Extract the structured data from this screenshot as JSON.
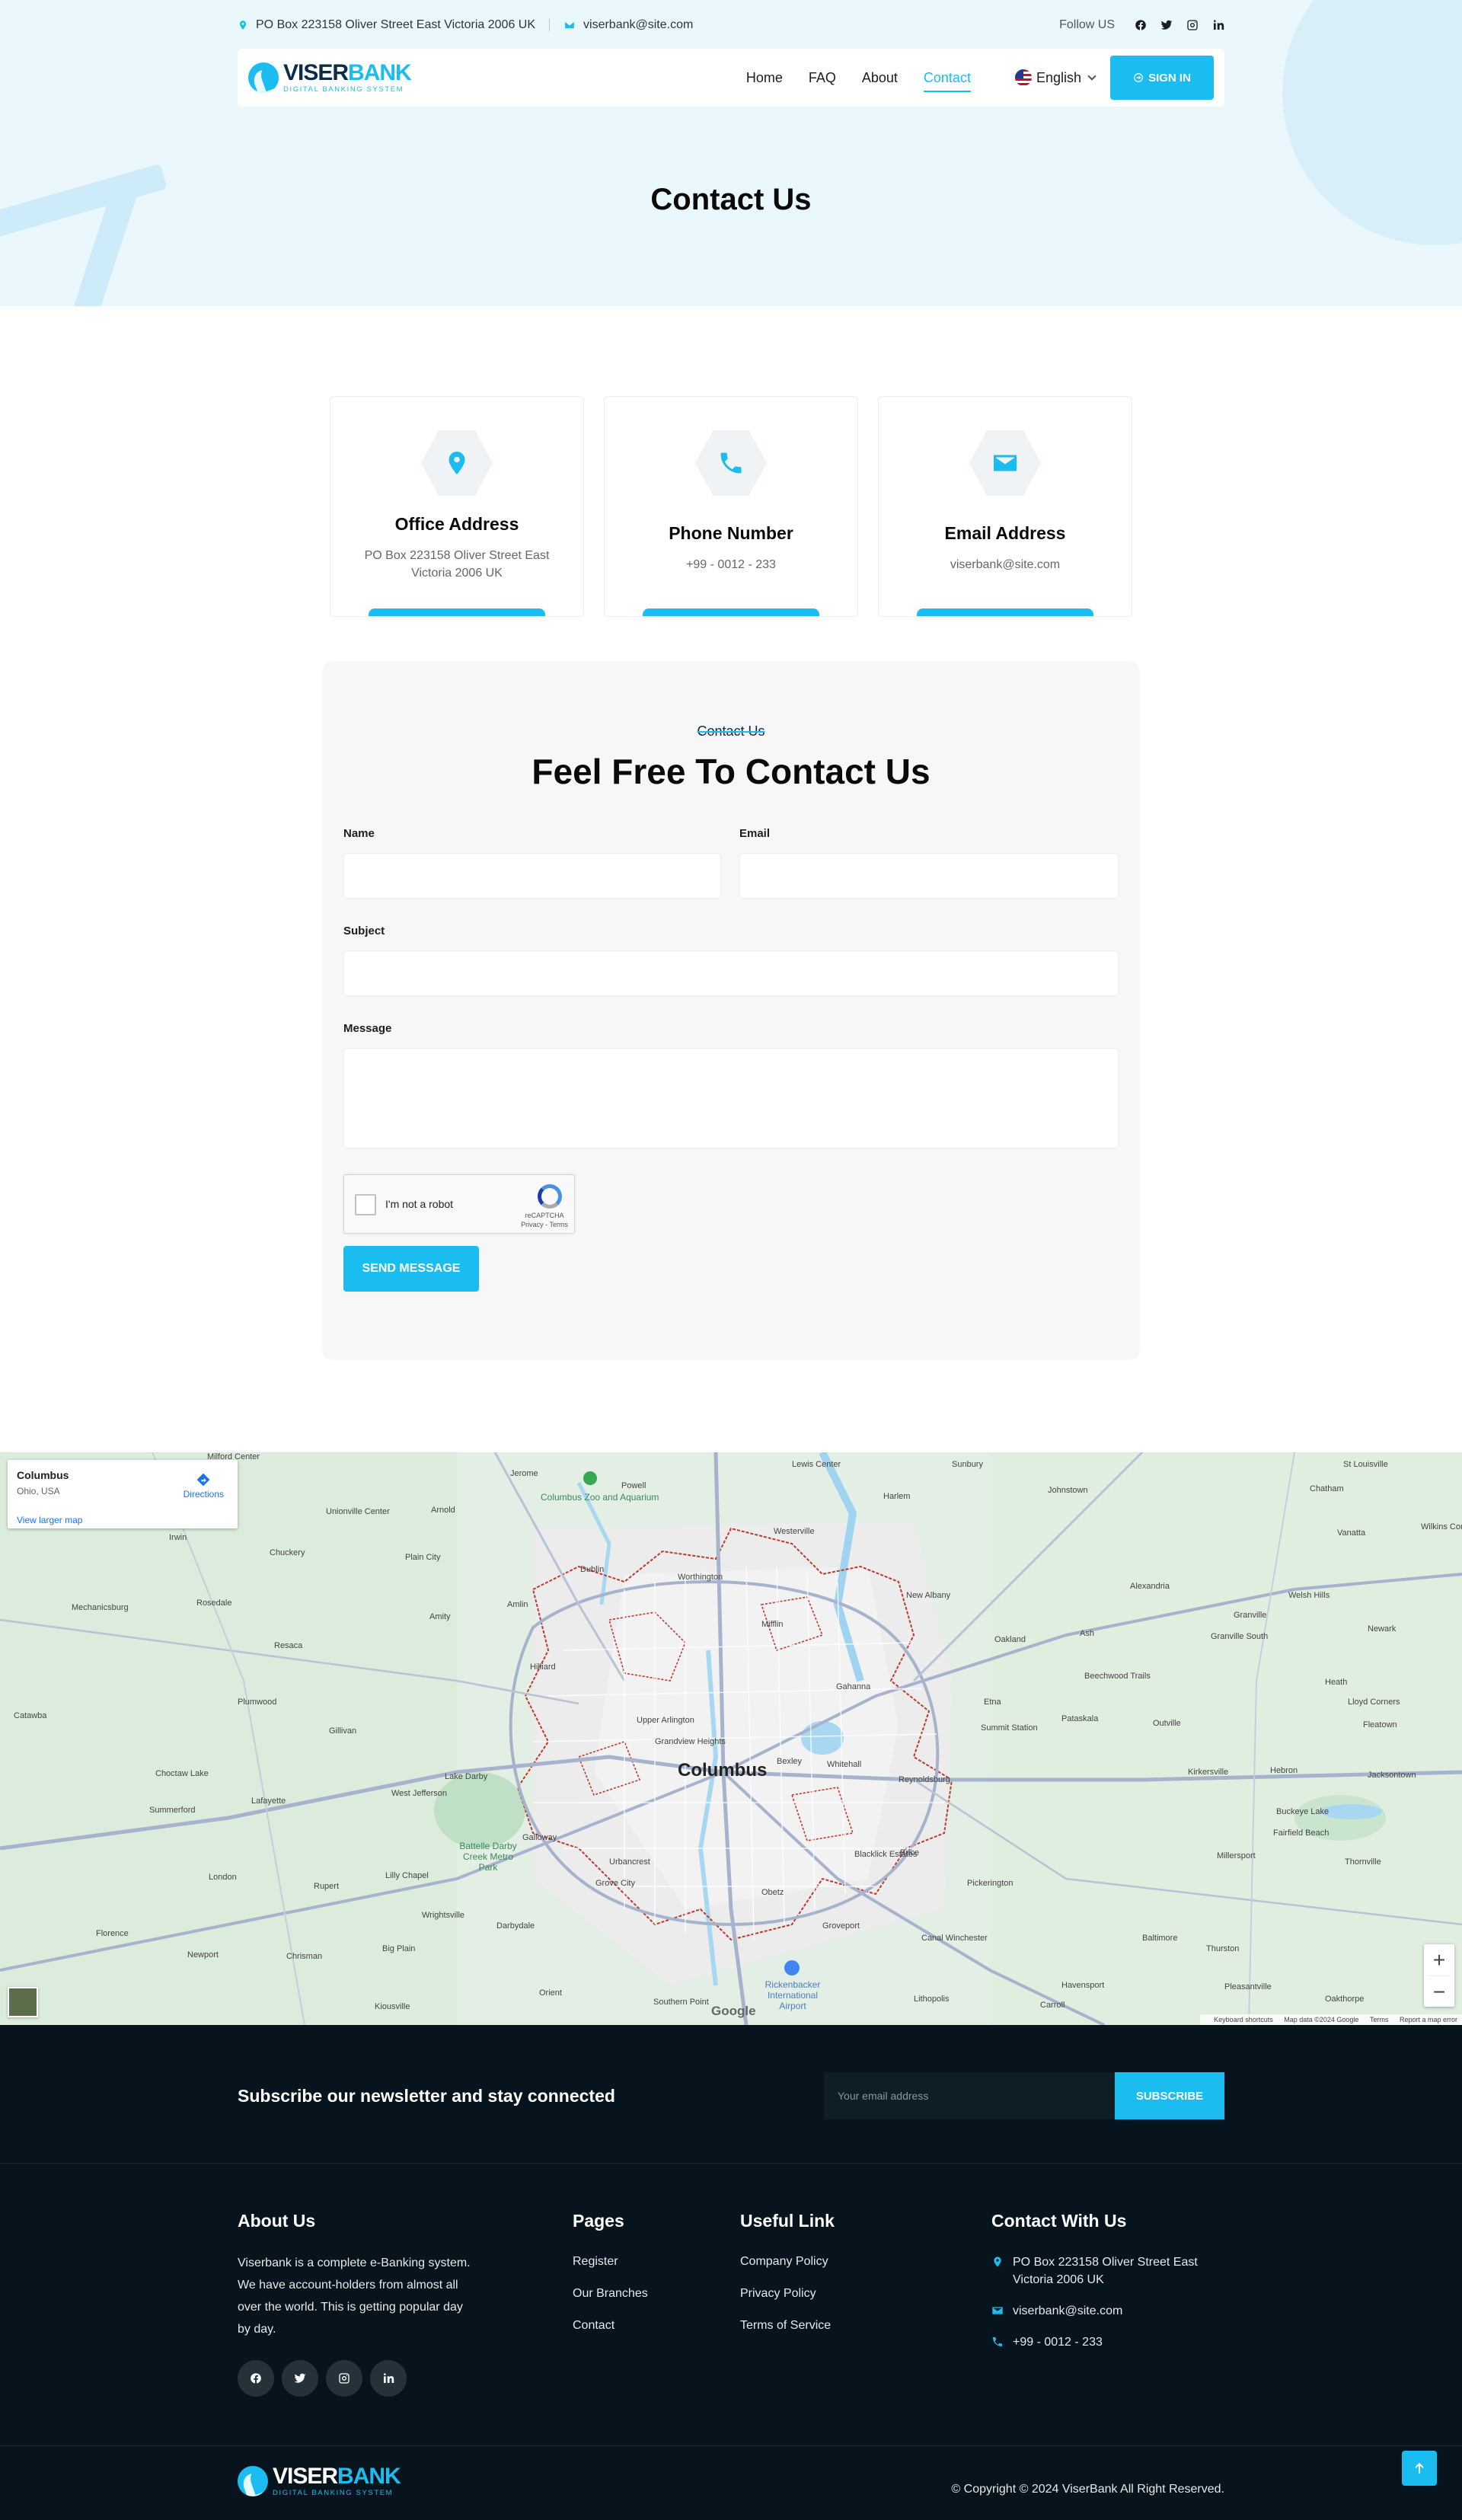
{
  "topbar": {
    "address": "PO Box 223158 Oliver Street East Victoria 2006 UK",
    "email": "viserbank@site.com",
    "follow_label": "Follow US",
    "socials": [
      "facebook-icon",
      "twitter-icon",
      "instagram-icon",
      "linkedin-icon"
    ]
  },
  "brand": {
    "name_part1": "VISER",
    "name_part2": "BANK",
    "tagline": "DIGITAL BANKING SYSTEM",
    "accent": "#1bbdf0",
    "dark": "#07141d"
  },
  "nav": {
    "links": [
      "Home",
      "FAQ",
      "About",
      "Contact"
    ],
    "active": "Contact",
    "language": "English",
    "signin_label": "SIGN IN"
  },
  "hero": {
    "title": "Contact Us"
  },
  "info_cards": [
    {
      "icon": "map-pin-icon",
      "title": "Office Address",
      "text": "PO Box 223158 Oliver Street East Victoria 2006 UK"
    },
    {
      "icon": "phone-icon",
      "title": "Phone Number",
      "text": "+99 - 0012 - 233"
    },
    {
      "icon": "envelope-icon",
      "title": "Email Address",
      "text": "viserbank@site.com"
    }
  ],
  "form": {
    "kicker": "Contact Us",
    "title": "Feel Free To Contact Us",
    "name_label": "Name",
    "email_label": "Email",
    "subject_label": "Subject",
    "message_label": "Message",
    "captcha_label": "I'm not a robot",
    "captcha_brand": "reCAPTCHA",
    "captcha_links": "Privacy - Terms",
    "submit_label": "SEND MESSAGE"
  },
  "map": {
    "place_title": "Columbus",
    "place_subtitle": "Ohio, USA",
    "larger_map_link": "View larger map",
    "directions_label": "Directions",
    "zoom_in": "+",
    "zoom_out": "−",
    "attribution": [
      "Keyboard shortcuts",
      "Map data ©2024 Google",
      "Terms",
      "Report a map error"
    ],
    "google_logo": "Google",
    "city_label": "Columbus",
    "labels": [
      "Milford Center",
      "Jerome",
      "Powell",
      "Plain City",
      "Dublin",
      "Worthington",
      "Westerville",
      "Harlem",
      "Johnstown",
      "St Louisville",
      "Chatham",
      "New Albany",
      "Gahanna",
      "Pataskala",
      "Reynoldsburg",
      "Hilliard",
      "Upper Arlington",
      "Grandview Heights",
      "Bexley",
      "Whitehall",
      "Grove City",
      "Obetz",
      "Groveport",
      "Canal Winchester",
      "Pickerington",
      "Lithopolis",
      "Orient",
      "Darbydale",
      "Urbancrest",
      "London",
      "Lilly Chapel",
      "Rosedale",
      "Mechanicsburg",
      "Catawba",
      "Plumwood",
      "Resaca",
      "Amity",
      "West Jefferson",
      "Lafayette",
      "Summerford",
      "Wrightsville",
      "Big Plain",
      "Newport",
      "Chrisman",
      "Florence",
      "Kiousville",
      "Southern Point",
      "Alexandria",
      "Granville",
      "Newark",
      "Heath",
      "Kirkersville",
      "Buckeye Lake",
      "Thornville",
      "Hebron",
      "Baltimore",
      "Thurston",
      "Millersport",
      "Pleasantville",
      "Oakthorpe",
      "Carroll",
      "Havensport",
      "Summit Station",
      "Outville",
      "Etna",
      "Ash",
      "Oakland",
      "Beechwood Trails",
      "Granville South",
      "Jacksontown",
      "Fairfield Beach",
      "Lloyd Corners",
      "Fleatown",
      "Welsh Hills",
      "Vanatta",
      "Wilkins Corner",
      "Brice",
      "Blacklick Estates",
      "Mifflin",
      "Unionville Center",
      "Amlin",
      "Chuckery",
      "Gillivan",
      "Lake Darby",
      "Galloway",
      "Choctaw Lake",
      "Rupert",
      "Irwin",
      "Arnold",
      "Lewis Center",
      "Sunbury"
    ],
    "parks": [
      "Columbus Zoo and Aquarium",
      "Battelle Darby Creek Metro Park",
      "Rickenbacker International Airport"
    ]
  },
  "footer": {
    "newsletter_title": "Subscribe our newsletter and stay connected",
    "newsletter_placeholder": "Your email address",
    "subscribe_label": "SUBSCRIBE",
    "about_title": "About Us",
    "about_text": "Viserbank is a complete e-Banking system. We have account-holders from almost all over the world. This is getting popular day by day.",
    "pages_title": "Pages",
    "pages": [
      "Register",
      "Our Branches",
      "Contact"
    ],
    "useful_title": "Useful Link",
    "useful": [
      "Company Policy",
      "Privacy Policy",
      "Terms of Service"
    ],
    "contact_title": "Contact With Us",
    "contact_address": "PO Box 223158 Oliver Street East Victoria 2006 UK",
    "contact_email": "viserbank@site.com",
    "contact_phone": "+99 - 0012 - 233",
    "copyright": "© Copyright © 2024 ViserBank All Right Reserved."
  }
}
